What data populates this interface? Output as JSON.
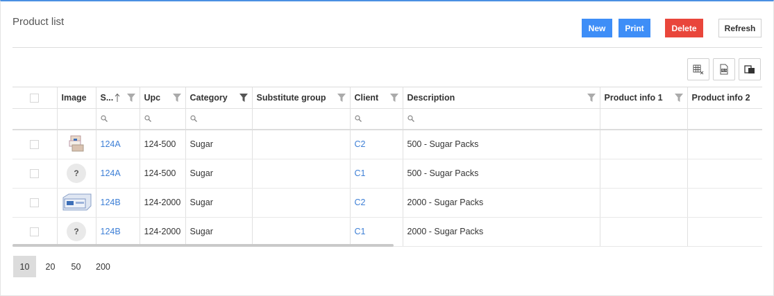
{
  "page": {
    "title": "Product list"
  },
  "toolbar": {
    "new_label": "New",
    "print_label": "Print",
    "delete_label": "Delete",
    "refresh_label": "Refresh"
  },
  "grid_tools": [
    {
      "icon": "column-chooser-icon"
    },
    {
      "icon": "export-excel-icon"
    },
    {
      "icon": "copy-icon"
    }
  ],
  "table": {
    "columns": [
      "",
      "Image",
      "S...",
      "Upc",
      "Category",
      "Substitute group",
      "Client",
      "Description",
      "Product info 1",
      "Product info 2"
    ],
    "rows": [
      {
        "image": "sugar-packs-thumbnail",
        "sku": "124A",
        "upc": "124-500",
        "category": "Sugar",
        "substitute_group": "",
        "client": "C2",
        "description": "500 - Sugar Packs",
        "info1": "",
        "info2": ""
      },
      {
        "image": "placeholder",
        "image_text": "?",
        "sku": "124A",
        "upc": "124-500",
        "category": "Sugar",
        "substitute_group": "",
        "client": "C1",
        "description": "500 - Sugar Packs",
        "info1": "",
        "info2": ""
      },
      {
        "image": "sugar-box-thumbnail",
        "sku": "124B",
        "upc": "124-2000",
        "category": "Sugar",
        "substitute_group": "",
        "client": "C2",
        "description": "2000 - Sugar Packs",
        "info1": "",
        "info2": ""
      },
      {
        "image": "placeholder",
        "image_text": "?",
        "sku": "124B",
        "upc": "124-2000",
        "category": "Sugar",
        "substitute_group": "",
        "client": "C1",
        "description": "2000 - Sugar Packs",
        "info1": "",
        "info2": ""
      }
    ]
  },
  "pager": {
    "sizes": [
      "10",
      "20",
      "50",
      "200"
    ],
    "selected": "10"
  },
  "colors": {
    "accent": "#3e8ef7",
    "danger": "#e9463b",
    "link": "#3d7fd6"
  }
}
